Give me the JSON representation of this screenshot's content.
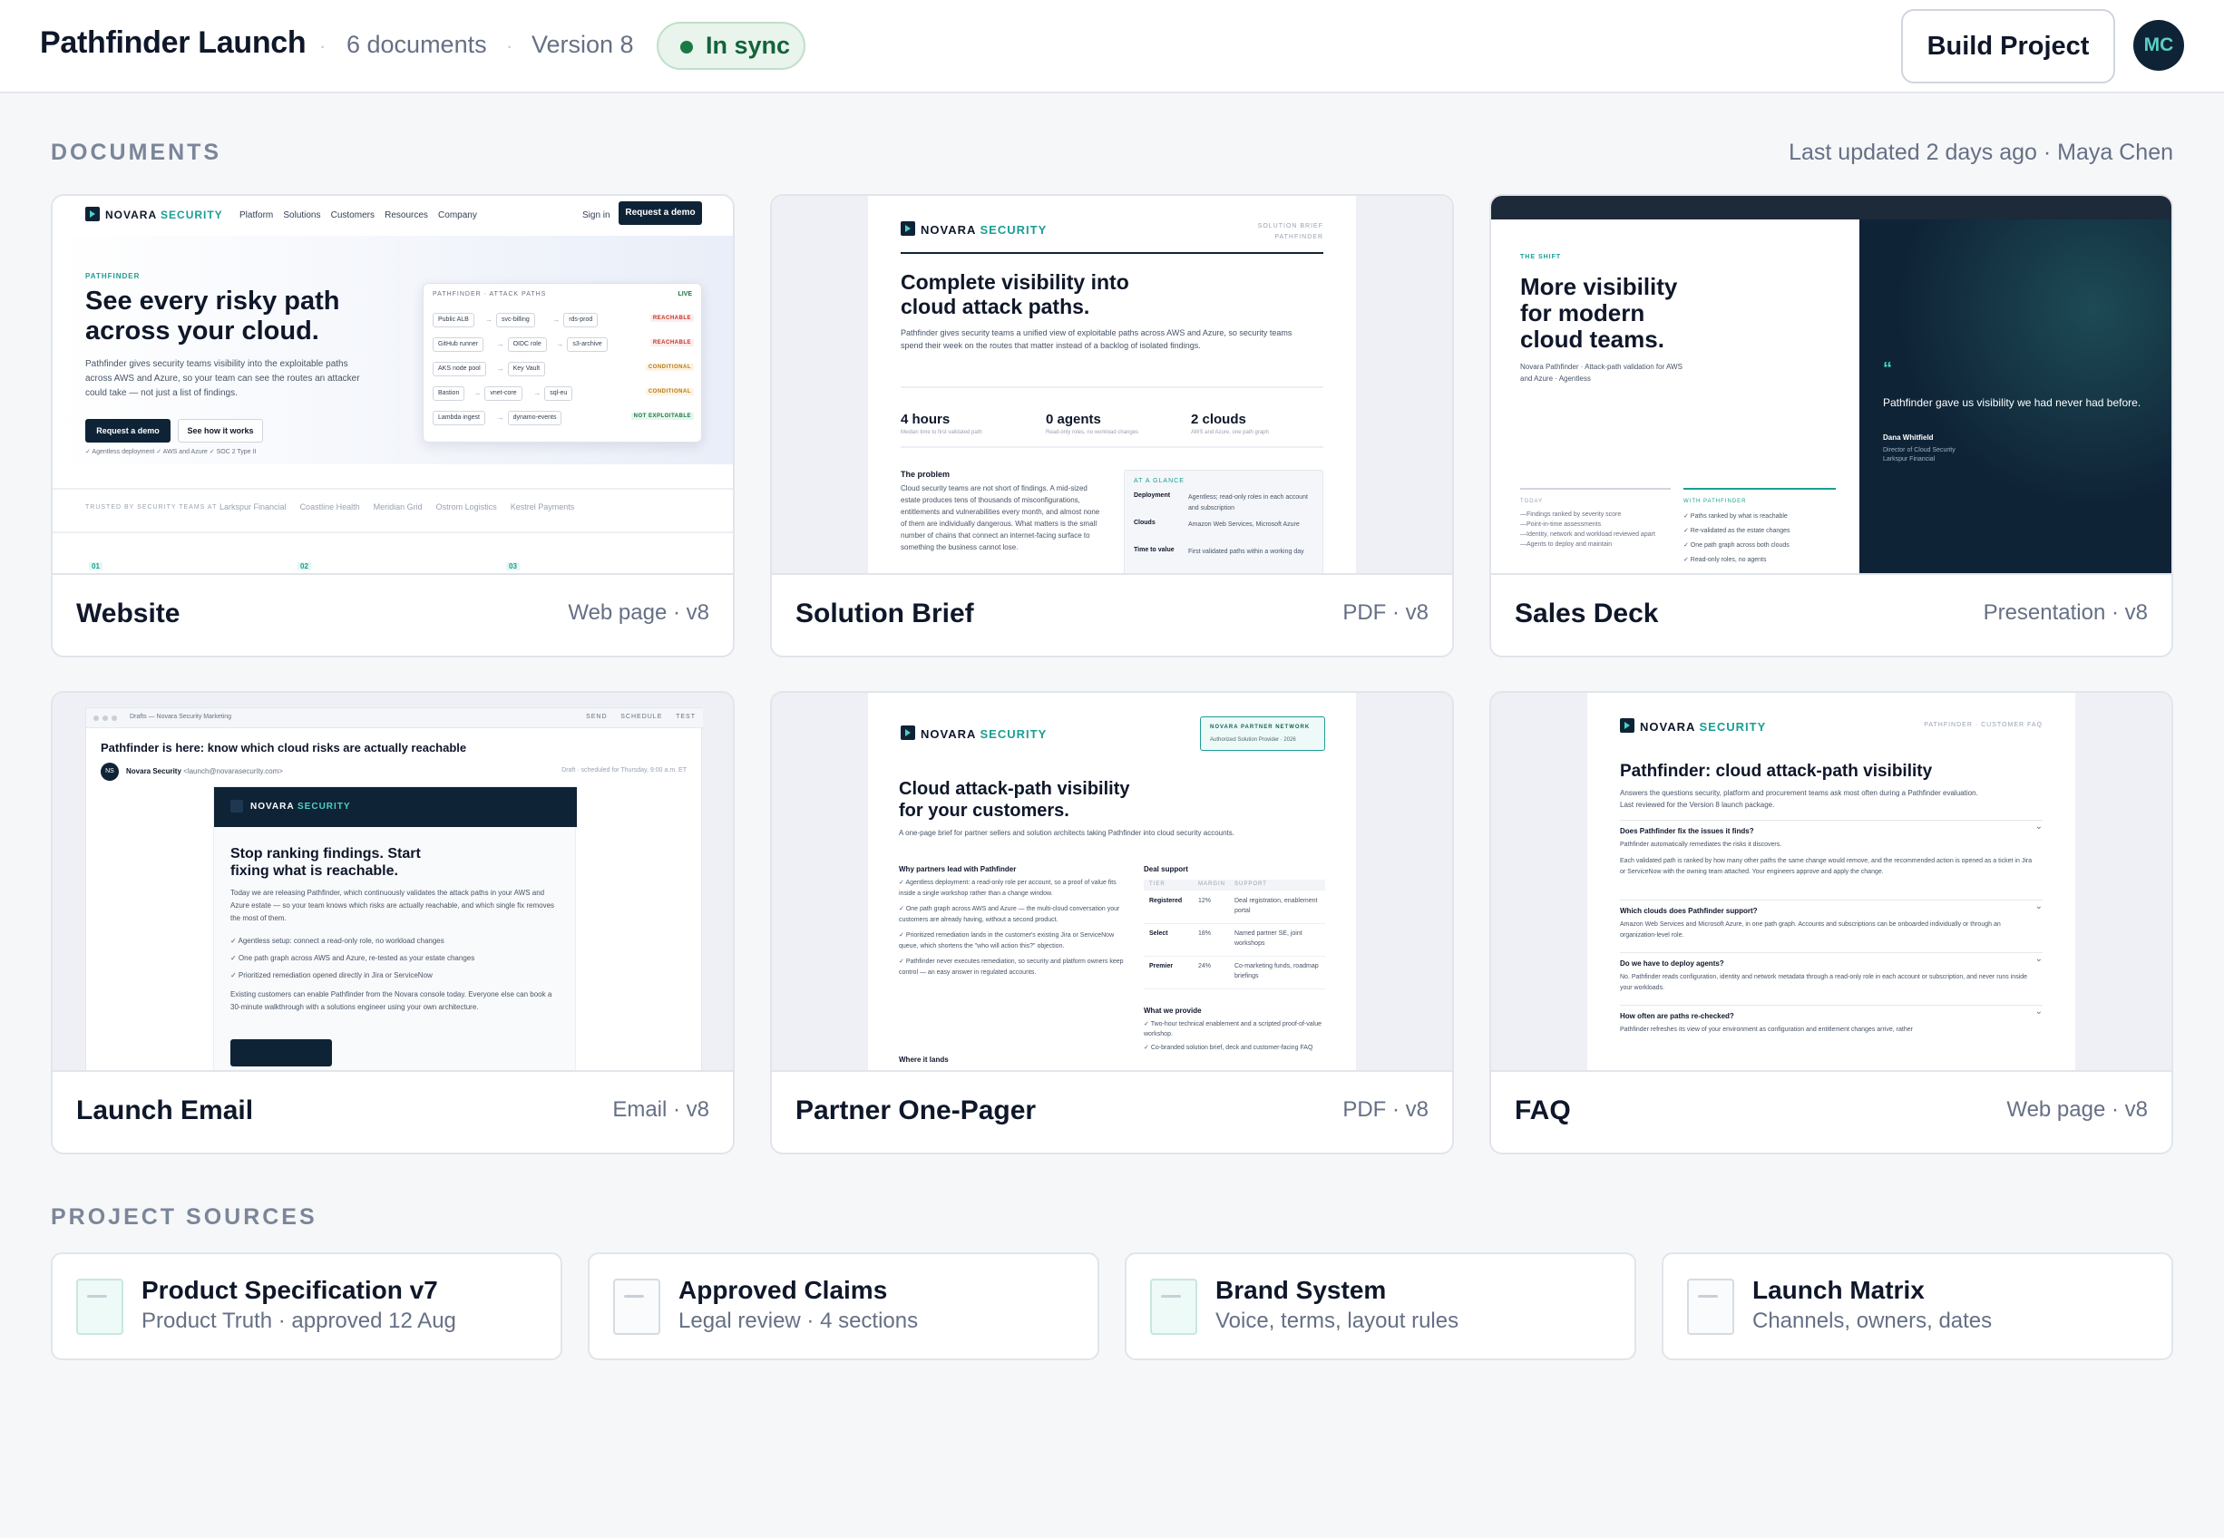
{
  "header": {
    "project_title": "Pathfinder Launch",
    "doc_count": "6 documents",
    "version": "Version 8",
    "sync_status": "In sync",
    "build_button": "Build Project",
    "avatar_initials": "MC"
  },
  "documents_section": {
    "label": "DOCUMENTS",
    "last_updated": "Last updated 2 days ago · Maya Chen"
  },
  "documents": [
    {
      "name": "Website",
      "type": "Web page · v8"
    },
    {
      "name": "Solution Brief",
      "type": "PDF · v8"
    },
    {
      "name": "Sales Deck",
      "type": "Presentation · v8"
    },
    {
      "name": "Launch Email",
      "type": "Email · v8"
    },
    {
      "name": "Partner One-Pager",
      "type": "PDF · v8"
    },
    {
      "name": "FAQ",
      "type": "Web page · v8"
    }
  ],
  "sources_section": {
    "label": "PROJECT SOURCES"
  },
  "sources": [
    {
      "title": "Product Specification v7",
      "subtitle": "Product Truth · approved 12 Aug"
    },
    {
      "title": "Approved Claims",
      "subtitle": "Legal review · 4 sections"
    },
    {
      "title": "Brand System",
      "subtitle": "Voice, terms, layout rules"
    },
    {
      "title": "Launch Matrix",
      "subtitle": "Channels, owners, dates"
    }
  ],
  "thumbs": {
    "brand": "NOVARA",
    "brand_accent": "SECURITY",
    "website": {
      "nav": [
        "Platform",
        "Solutions",
        "Customers",
        "Resources",
        "Company"
      ],
      "signin": "Sign in",
      "cta": "Request a demo",
      "eyebrow": "PATHFINDER",
      "headline1": "See every risky path",
      "headline2": "across your cloud.",
      "body": "Pathfinder gives security teams visibility into the exploitable paths across AWS and Azure, so your team can see the routes an attacker could take — not just a list of findings.",
      "btn1": "Request a demo",
      "btn2": "See how it works",
      "checks": "✓ Agentless deployment    ✓ AWS and Azure    ✓ SOC 2 Type II",
      "panel_title": "PATHFINDER · ATTACK PATHS",
      "panel_live": "LIVE",
      "rows": [
        {
          "a": "Public ALB",
          "b": "svc-billing",
          "c": "rds-prod",
          "s": "REACHABLE"
        },
        {
          "a": "GitHub runner",
          "b": "OIDC role",
          "c": "s3-archive",
          "s": "REACHABLE"
        },
        {
          "a": "AKS node pool",
          "b": "Key Vault",
          "c": "",
          "s": "CONDITIONAL"
        },
        {
          "a": "Bastion",
          "b": "vnet-core",
          "c": "sql-eu",
          "s": "CONDITIONAL"
        },
        {
          "a": "Lambda ingest",
          "b": "dynamo-events",
          "c": "",
          "s": "NOT EXPLOITABLE"
        }
      ],
      "trusted": "TRUSTED BY SECURITY TEAMS AT",
      "logos": [
        "Larkspur Financial",
        "Coastline Health",
        "Meridian Grid",
        "Ostrom Logistics",
        "Kestrel Payments"
      ],
      "steps": [
        "01",
        "02",
        "03"
      ]
    },
    "brief": {
      "tag1": "SOLUTION BRIEF",
      "tag2": "PATHFINDER",
      "title1": "Complete visibility into",
      "title2": "cloud attack paths.",
      "intro": "Pathfinder gives security teams a unified view of exploitable paths across AWS and Azure, so security teams spend their week on the routes that matter instead of a backlog of isolated findings.",
      "stats": [
        {
          "v": "4 hours",
          "l": "Median time to first validated path"
        },
        {
          "v": "0 agents",
          "l": "Read-only roles, no workload changes"
        },
        {
          "v": "2 clouds",
          "l": "AWS and Azure, one path graph"
        }
      ],
      "problem_h": "The problem",
      "problem": "Cloud security teams are not short of findings. A mid-sized estate produces tens of thousands of misconfigurations, entitlements and vulnerabilities every month, and almost none of them are individually dangerous. What matters is the small number of chains that connect an internet-facing surface to something the business cannot lose.",
      "glance_h": "AT A GLANCE",
      "glance": [
        {
          "k": "Deployment",
          "v": "Agentless; read-only roles in each account and subscription"
        },
        {
          "k": "Clouds",
          "v": "Amazon Web Services, Microsoft Azure"
        },
        {
          "k": "Time to value",
          "v": "First validated paths within a working day"
        }
      ]
    },
    "deck": {
      "eyebrow": "THE SHIFT",
      "title1": "More visibility",
      "title2": "for modern",
      "title3": "cloud teams.",
      "sub": "Novara Pathfinder · Attack-path validation for AWS and Azure · Agentless",
      "quote_mark": "“",
      "quote": "Pathfinder gave us visibility we had never had before.",
      "who": "Dana Whitfield",
      "role1": "Director of Cloud Security",
      "role2": "Larkspur Financial",
      "today_h": "TODAY",
      "today": [
        "—Findings ranked by severity score",
        "—Point-in-time assessments",
        "—Identity, network and workload reviewed apart",
        "—Agents to deploy and maintain"
      ],
      "with_h": "WITH PATHFINDER",
      "with": [
        "✓ Paths ranked by what is reachable",
        "✓ Re-validated as the estate changes",
        "✓ One path graph across both clouds",
        "✓ Read-only roles, no agents"
      ]
    },
    "email": {
      "window_title": "Drafts — Novara Security Marketing",
      "actions": [
        "SEND",
        "SCHEDULE",
        "TEST"
      ],
      "subject": "Pathfinder is here: know which cloud risks are actually reachable",
      "from_initials": "NS",
      "from": "Novara Security",
      "from_addr": "<launch@novarasecurity.com>",
      "scheduled": "Draft · scheduled for Thursday, 9:00 a.m. ET",
      "h1": "Stop ranking findings. Start",
      "h2": "fixing what is reachable.",
      "body": "Today we are releasing Pathfinder, which continuously validates the attack paths in your AWS and Azure estate — so your team knows which risks are actually reachable, and which single fix removes the most of them.",
      "bullets": [
        "✓ Agentless setup: connect a read-only role, no workload changes",
        "✓ One path graph across AWS and Azure, re-tested as your estate changes",
        "✓ Prioritized remediation opened directly in Jira or ServiceNow"
      ],
      "footer": "Existing customers can enable Pathfinder from the Novara console today. Everyone else can book a 30-minute walkthrough with a solutions engineer using your own architecture."
    },
    "partner": {
      "badge1": "NOVARA PARTNER NETWORK",
      "badge2": "Authorized Solution Provider · 2026",
      "title1": "Cloud attack-path visibility",
      "title2": "for your customers.",
      "intro": "A one-page brief for partner sellers and solution architects taking Pathfinder into cloud security accounts.",
      "why_h": "Why partners lead with Pathfinder",
      "why": [
        "Agentless deployment: a read-only role per account, so a proof of value fits inside a single workshop rather than a change window.",
        "One path graph across AWS and Azure — the multi-cloud conversation your customers are already having, without a second product.",
        "Prioritized remediation lands in the customer's existing Jira or ServiceNow queue, which shortens the \"who will action this?\" objection.",
        "Pathfinder never executes remediation, so security and platform owners keep control — an easy answer in regulated accounts."
      ],
      "where_h": "Where it lands",
      "deal_h": "Deal support",
      "deal_cols": [
        "TIER",
        "MARGIN",
        "SUPPORT"
      ],
      "deal_rows": [
        {
          "t": "Registered",
          "m": "12%",
          "s": "Deal registration, enablement portal"
        },
        {
          "t": "Select",
          "m": "18%",
          "s": "Named partner SE, joint workshops"
        },
        {
          "t": "Premier",
          "m": "24%",
          "s": "Co-marketing funds, roadmap briefings"
        }
      ],
      "provide_h": "What we provide",
      "provide": [
        "Two-hour technical enablement and a scripted proof-of-value workshop.",
        "Co-branded solution brief, deck and customer-facing FAQ"
      ]
    },
    "faq": {
      "tag": "PATHFINDER · CUSTOMER FAQ",
      "title": "Pathfinder: cloud attack-path visibility",
      "intro": "Answers the questions security, platform and procurement teams ask most often during a Pathfinder evaluation. Last reviewed for the Version 8 launch package.",
      "items": [
        {
          "q": "Does Pathfinder fix the issues it finds?",
          "a": "Pathfinder automatically remediates the risks it discovers.",
          "a2": "Each validated path is ranked by how many other paths the same change would remove, and the recommended action is opened as a ticket in Jira or ServiceNow with the owning team attached. Your engineers approve and apply the change."
        },
        {
          "q": "Which clouds does Pathfinder support?",
          "a": "Amazon Web Services and Microsoft Azure, in one path graph. Accounts and subscriptions can be onboarded individually or through an organization-level role.",
          "a2": ""
        },
        {
          "q": "Do we have to deploy agents?",
          "a": "No. Pathfinder reads configuration, identity and network metadata through a read-only role in each account or subscription, and never runs inside your workloads.",
          "a2": ""
        },
        {
          "q": "How often are paths re-checked?",
          "a": "Pathfinder refreshes its view of your environment as configuration and entitlement changes arrive, rather",
          "a2": ""
        }
      ]
    }
  }
}
